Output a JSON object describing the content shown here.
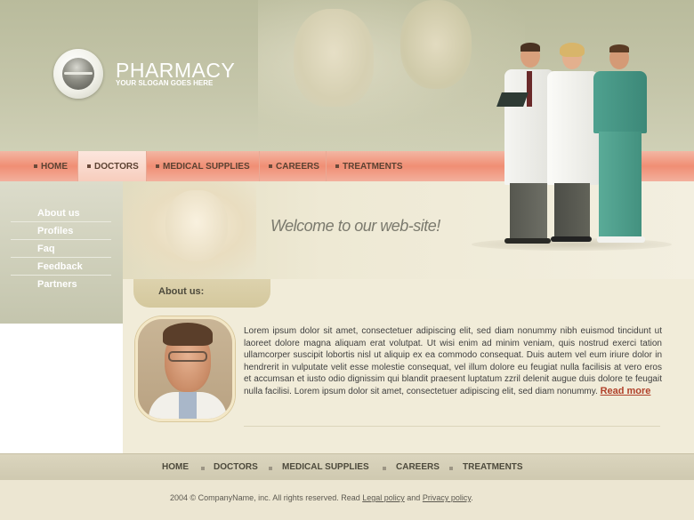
{
  "brand": {
    "name": "PHARMACY",
    "slogan": "YOUR SLOGAN GOES HERE"
  },
  "nav": {
    "items": [
      {
        "label": "HOME"
      },
      {
        "label": "DOCTORS",
        "active": true
      },
      {
        "label": "MEDICAL SUPPLIES"
      },
      {
        "label": "CAREERS"
      },
      {
        "label": "TREATMENTS"
      }
    ]
  },
  "sidebar": {
    "items": [
      {
        "label": "About us"
      },
      {
        "label": "Profiles"
      },
      {
        "label": "Faq"
      },
      {
        "label": "Feedback"
      },
      {
        "label": "Partners"
      }
    ]
  },
  "welcome": {
    "text": "Welcome to our web-site!"
  },
  "about": {
    "title": "About us:",
    "body": "Lorem ipsum dolor sit amet, consectetuer adipiscing elit, sed diam nonummy nibh euismod tincidunt ut laoreet dolore magna aliquam erat volutpat. Ut wisi enim ad minim veniam, quis nostrud exerci tation ullamcorper suscipit lobortis nisl ut aliquip ex ea commodo consequat. Duis autem vel eum iriure dolor in hendrerit in vulputate velit esse molestie consequat, vel illum dolore eu feugiat nulla facilisis at vero eros et accumsan et iusto odio dignissim qui blandit praesent luptatum zzril delenit augue duis dolore te feugait nulla facilisi. Lorem ipsum dolor sit amet, consectetuer adipiscing elit, sed diam nonummy.",
    "read_more": "Read more"
  },
  "footer": {
    "links": [
      {
        "label": "HOME"
      },
      {
        "label": "DOCTORS"
      },
      {
        "label": "MEDICAL SUPPLIES"
      },
      {
        "label": "CAREERS"
      },
      {
        "label": "TREATMENTS"
      }
    ],
    "copyright_prefix": "2004 © CompanyName, inc. All rights reserved. Read",
    "legal_link": "Legal policy",
    "and_text": "and",
    "privacy_link": "Privacy policy",
    "period": "."
  },
  "colors": {
    "header_bg": "#c5c6aa",
    "nav_accent": "#f08e74",
    "read_more": "#b0412a",
    "main_bg": "#f1ecd9"
  }
}
